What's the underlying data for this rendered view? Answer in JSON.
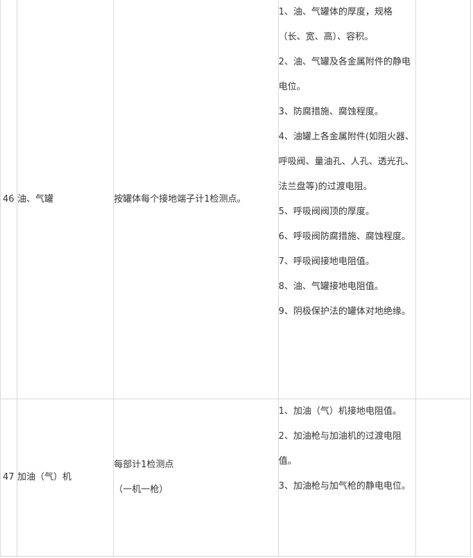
{
  "rows": [
    {
      "number": "46",
      "name": "油、气罐",
      "method": [
        "按罐体每个接地端子计1检测点。"
      ],
      "items": [
        "1、油、气罐体的厚度，规格（长、宽、高）、容积。",
        "2、油、气罐及各金属附件的静电电位。",
        "3、防腐措施、腐蚀程度。",
        "4、油罐上各金属附件(如阻火器、呼吸阀、量油孔、人孔、透光孔、法兰盘等)的过渡电阻。",
        "5、呼吸阀阀顶的厚度。",
        "6、呼吸阀防腐措施、腐蚀程度。",
        "7、呼吸阀接地电阻值。",
        "8、油、气罐接地电阻值。",
        "9、阴极保护法的罐体对地绝缘。"
      ]
    },
    {
      "number": "47",
      "name": "加油（气）机",
      "method": [
        "每部计1检测点",
        "（一机一枪）"
      ],
      "items": [
        "1、加油（气）机接地电阻值。",
        "2、加油枪与加油机的过渡电阻值。",
        "3、加油枪与加气枪的静电电位。"
      ]
    }
  ]
}
